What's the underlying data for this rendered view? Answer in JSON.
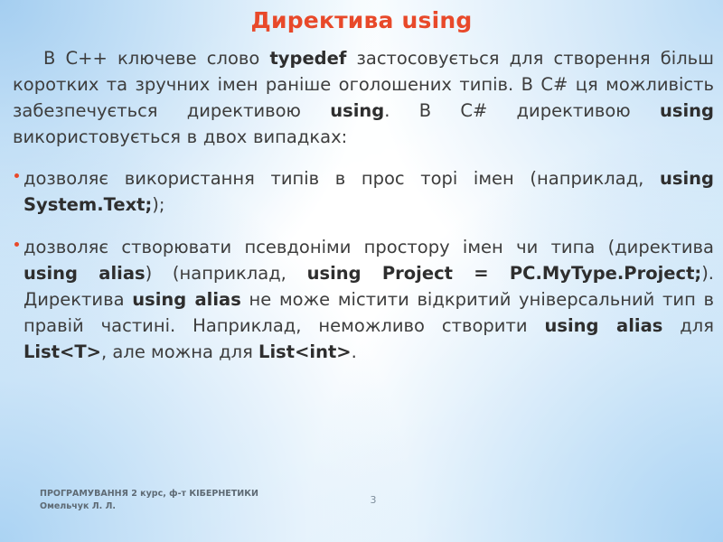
{
  "slide": {
    "title": "Директива using",
    "accent_color": "#e8492a",
    "body_text_color": "#3d3d3d",
    "background_colors": [
      "#bfdcf4",
      "#ffffff",
      "#b9d9f3"
    ],
    "intro_paragraph": {
      "segments": [
        {
          "text": "В С++ ключеве слово ",
          "bold": false
        },
        {
          "text": "typedef",
          "bold": true
        },
        {
          "text": " застосовується для створення більш коротких та зручних імен раніше оголошених типів. В С# ця можливість забезпечується директивою ",
          "bold": false
        },
        {
          "text": "using",
          "bold": true
        },
        {
          "text": ". В С# директивою ",
          "bold": false
        },
        {
          "text": "using",
          "bold": true
        },
        {
          "text": " використовується в двох випадках:",
          "bold": false
        }
      ]
    },
    "bullets": [
      {
        "bullet_glyph": "•",
        "segments": [
          {
            "text": "дозволяє використання типів в прос торі імен (наприклад, ",
            "bold": false
          },
          {
            "text": "using System.Text;",
            "bold": true
          },
          {
            "text": ");",
            "bold": false
          }
        ]
      },
      {
        "bullet_glyph": "•",
        "segments": [
          {
            "text": "дозволяє створювати псевдоніми простору імен чи типа (директива ",
            "bold": false
          },
          {
            "text": "using alias",
            "bold": true
          },
          {
            "text": ") (наприклад, ",
            "bold": false
          },
          {
            "text": "using Project = PC.MyType.Project;",
            "bold": true
          },
          {
            "text": "). Директива ",
            "bold": false
          },
          {
            "text": "using alias",
            "bold": true
          },
          {
            "text": " не може містити відкритий універсальний тип в правій частині. Наприклад, неможливо створити ",
            "bold": false
          },
          {
            "text": "using alias",
            "bold": true
          },
          {
            "text": " для ",
            "bold": false
          },
          {
            "text": "List<T>",
            "bold": true
          },
          {
            "text": ", але можна для ",
            "bold": false
          },
          {
            "text": "List<int>",
            "bold": true
          },
          {
            "text": ".",
            "bold": false
          }
        ]
      }
    ],
    "footer": {
      "line1": "ПРОГРАМУВАННЯ 2 курс, ф-т КІБЕРНЕТИКИ",
      "line2": "Омельчук Л. Л."
    },
    "page_number": "3"
  }
}
